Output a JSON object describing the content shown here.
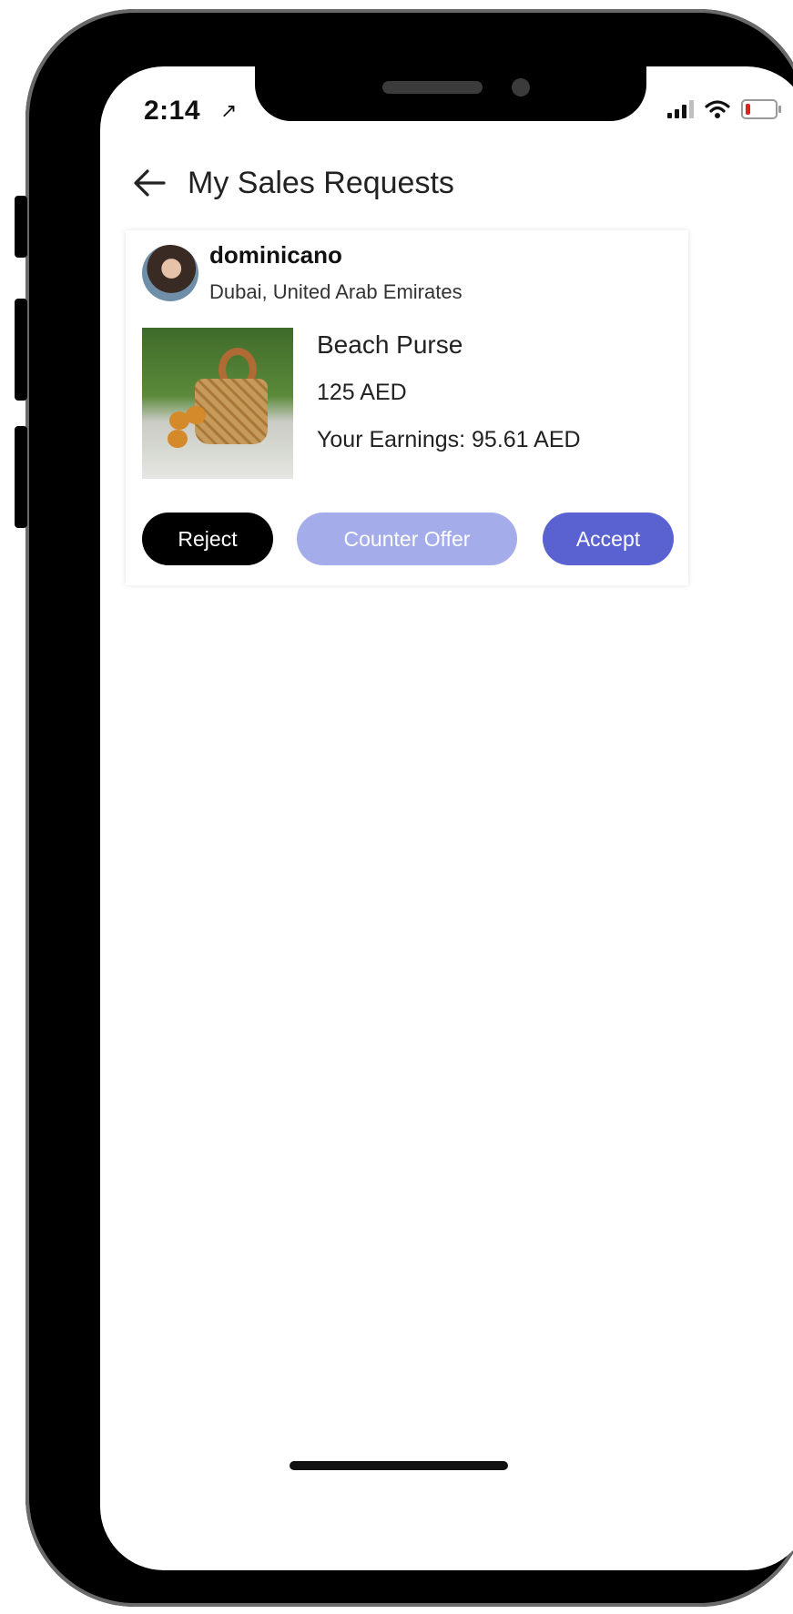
{
  "status_bar": {
    "time": "2:14",
    "location_arrow": "↗"
  },
  "header": {
    "title": "My Sales Requests"
  },
  "request": {
    "username": "dominicano",
    "location": "Dubai, United Arab Emirates",
    "product_name": "Beach Purse",
    "price": "125 AED",
    "earnings": "Your Earnings: 95.61 AED",
    "buttons": {
      "reject": "Reject",
      "counter_offer": "Counter Offer",
      "accept": "Accept"
    }
  },
  "icons": {
    "back": "back-arrow-icon",
    "location": "location-arrow-icon",
    "signal": "cellular-signal-icon",
    "wifi": "wifi-icon",
    "battery": "battery-icon"
  },
  "colors": {
    "accept": "#5a62d2",
    "counter_offer": "#a4acea",
    "reject": "#000000",
    "battery_low": "#e02020"
  },
  "battery_level": 0.15
}
